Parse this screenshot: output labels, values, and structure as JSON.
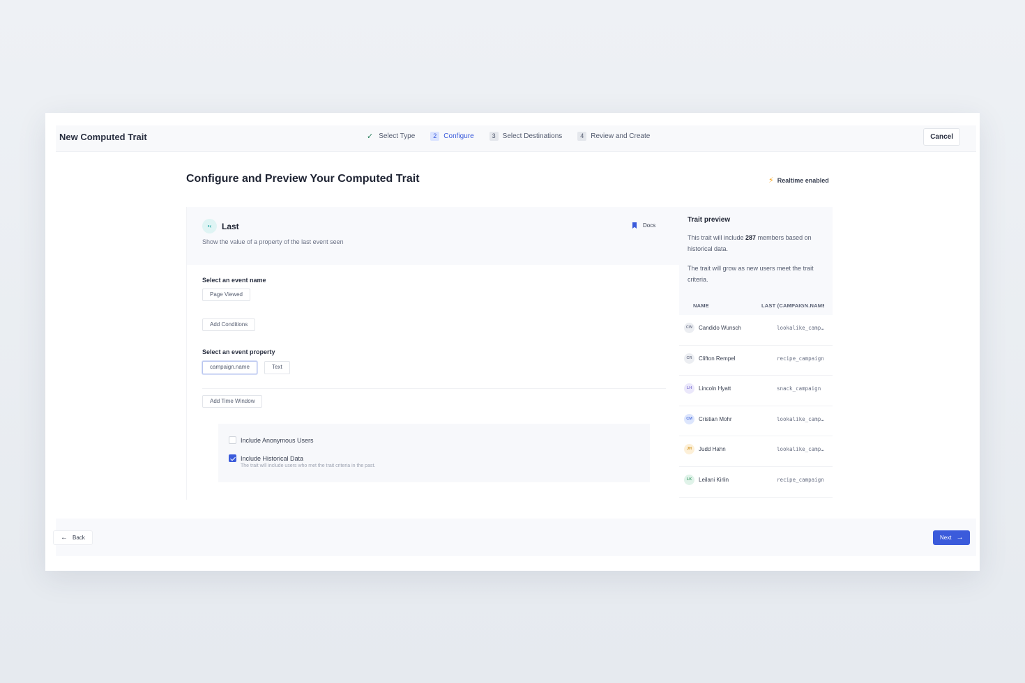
{
  "header": {
    "title": "New Computed Trait",
    "steps": [
      {
        "num": "",
        "label": "Select Type",
        "state": "done"
      },
      {
        "num": "2",
        "label": "Configure",
        "state": "active"
      },
      {
        "num": "3",
        "label": "Select Destinations",
        "state": "pending"
      },
      {
        "num": "4",
        "label": "Review and Create",
        "state": "pending"
      }
    ],
    "cancel_label": "Cancel"
  },
  "page": {
    "title": "Configure and Preview Your Computed Trait",
    "realtime_label": "Realtime enabled"
  },
  "config": {
    "type_title": "Last",
    "type_desc": "Show the value of a property of the last event seen",
    "docs_label": "Docs",
    "event_name_label": "Select an event name",
    "event_name_value": "Page Viewed",
    "add_conditions_label": "Add Conditions",
    "event_property_label": "Select an event property",
    "event_property_value": "campaign.name",
    "event_property_type": "Text",
    "add_time_window_label": "Add Time Window",
    "include_anonymous": {
      "label": "Include Anonymous Users",
      "checked": false
    },
    "include_historical": {
      "label": "Include Historical Data",
      "checked": true,
      "help": "The trait will include users who met the trait criteria in the past."
    }
  },
  "preview": {
    "title": "Trait preview",
    "text1_prefix": "This trait will include ",
    "member_count": "287",
    "text1_suffix": " members based on historical data.",
    "text2": "The trait will grow as new users meet the trait criteria.",
    "col_name": "NAME",
    "col_value": "LAST (CAMPAIGN.NAME)",
    "rows": [
      {
        "initials": "CW",
        "name": "Candido Wunsch",
        "value": "lookalike_campaign",
        "color": "#eceef2",
        "fg": "#7a8194"
      },
      {
        "initials": "CR",
        "name": "Clifton Rempel",
        "value": "recipe_campaign",
        "color": "#eceef2",
        "fg": "#7a8194"
      },
      {
        "initials": "LH",
        "name": "Lincoln Hyatt",
        "value": "snack_campaign",
        "color": "#ebe8fb",
        "fg": "#8a7fd6"
      },
      {
        "initials": "CM",
        "name": "Cristian Mohr",
        "value": "lookalike_campaign",
        "color": "#dde6fd",
        "fg": "#5b7be0"
      },
      {
        "initials": "JH",
        "name": "Judd Hahn",
        "value": "lookalike_campaign",
        "color": "#fdf0d8",
        "fg": "#d49a2a"
      },
      {
        "initials": "LK",
        "name": "Leilani Kirlin",
        "value": "recipe_campaign",
        "color": "#e0f3e9",
        "fg": "#4fa577"
      }
    ]
  },
  "footer": {
    "back_label": "Back",
    "next_label": "Next"
  },
  "colors": {
    "accent": "#3b5bdb",
    "realtime": "#f5a623"
  }
}
